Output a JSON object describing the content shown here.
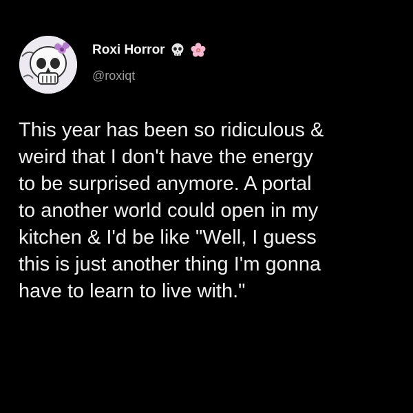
{
  "tweet": {
    "author": {
      "display_name": "Roxi Horror",
      "handle": "@roxiqt",
      "avatar": "skull-avatar",
      "name_emojis": [
        "skull-icon",
        "cherry-blossom-icon"
      ]
    },
    "text": "This year has been so ridiculous &\nweird that I don't have the energy\nto be surprised anymore. A portal\nto another world could open in my\nkitchen & I'd be like \"Well, I guess\nthis is just another thing I'm gonna\nhave to learn to live with.\""
  },
  "colors": {
    "background": "#000000",
    "text": "#f0f0f0",
    "handle": "#9b9b9b"
  }
}
